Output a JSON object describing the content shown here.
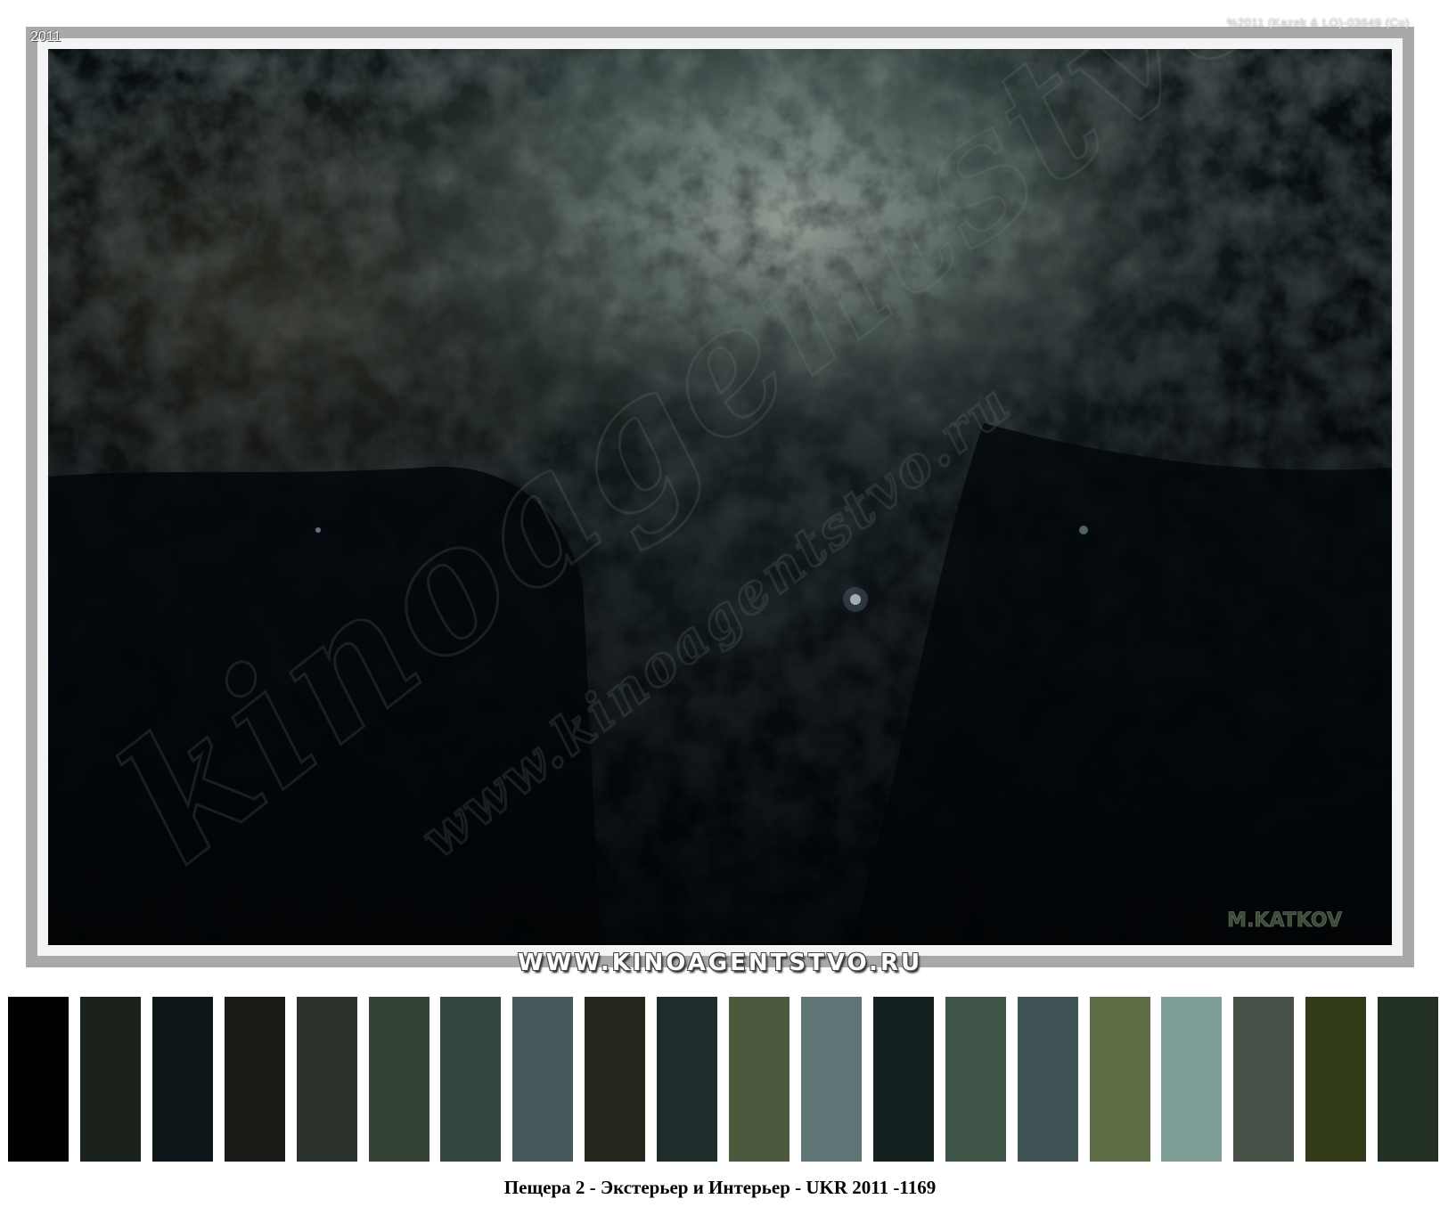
{
  "photo": {
    "year": "2011",
    "copyright": "%2011 (Kazek & LO)-03649 (Co)",
    "signature": "M.KATKOV",
    "watermark_large": "kinoagentstvo",
    "watermark_small": "www.kinoagentstvo.ru",
    "subject": "cave-rock-wall"
  },
  "website": "WWW.KINOAGENTSTVO.RU",
  "palette": {
    "swatches": [
      {
        "color": "#000000"
      },
      {
        "color": "#1b221c"
      },
      {
        "color": "#0f161a"
      },
      {
        "color": "#181b15"
      },
      {
        "color": "#2a322b"
      },
      {
        "color": "#344334"
      },
      {
        "color": "#354641"
      },
      {
        "color": "#46595d"
      },
      {
        "color": "#25271c"
      },
      {
        "color": "#1e2c2b"
      },
      {
        "color": "#4c593d"
      },
      {
        "color": "#5d7574"
      },
      {
        "color": "#152020"
      },
      {
        "color": "#3e5447"
      },
      {
        "color": "#3e5254"
      },
      {
        "color": "#5f6d47"
      },
      {
        "color": "#7f9e98"
      },
      {
        "color": "#475047"
      },
      {
        "color": "#313b18"
      },
      {
        "color": "#223022"
      }
    ]
  },
  "caption": "Пещера 2 - Экстерьер и Интерьер - UKR 2011 -1169"
}
